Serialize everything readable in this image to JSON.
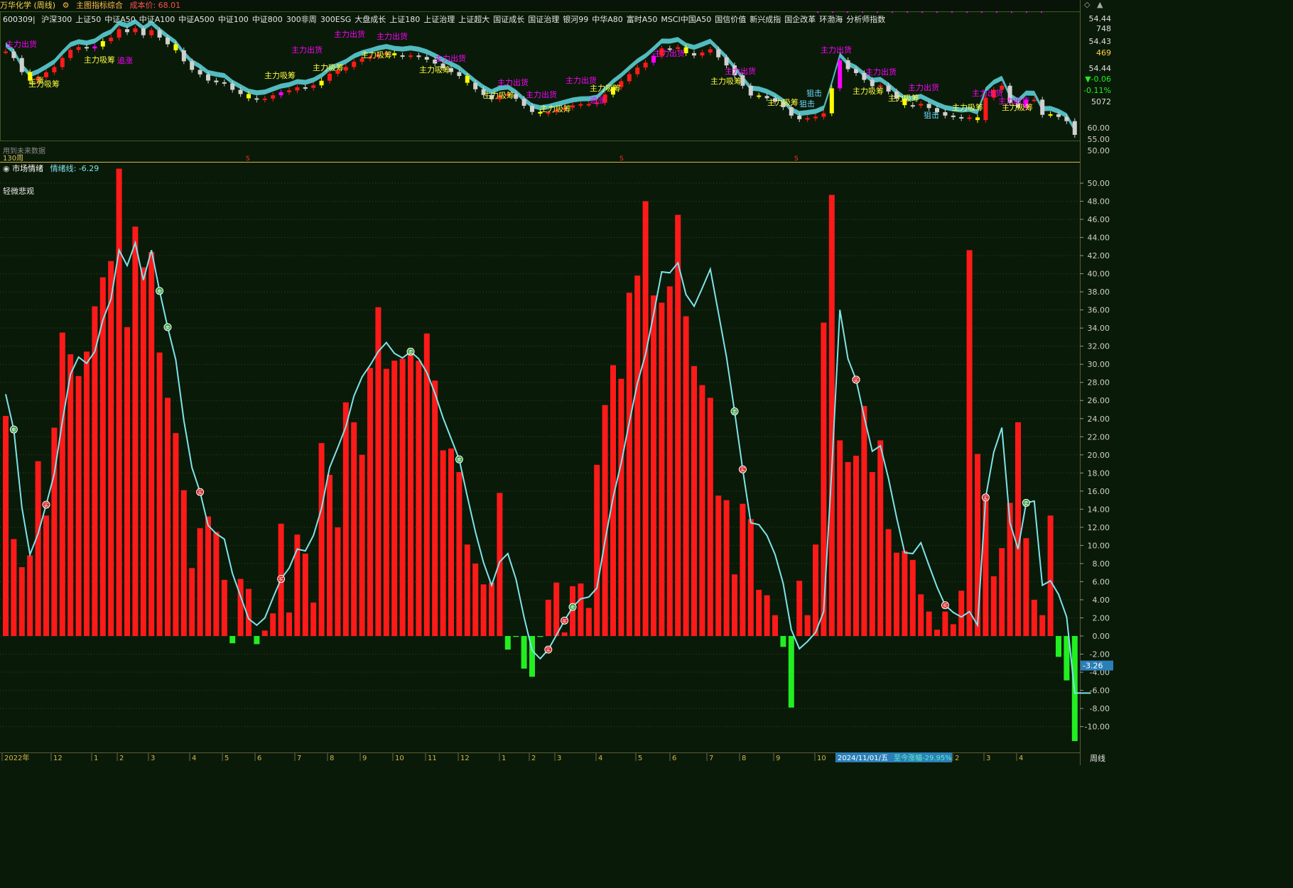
{
  "header": {
    "stock_name": "万华化学 (周线)",
    "indicator_name": "主图指标综合",
    "cost_label": "成本价: 68.01",
    "index_code": "600309",
    "index_list": [
      "沪深300",
      "上证50",
      "中证A50",
      "中证A100",
      "中证A500",
      "中证100",
      "中证800",
      "300非周",
      "300ESG",
      "大盘成长",
      "上证180",
      "上证治理",
      "上证超大",
      "国证成长",
      "国证治理",
      "银河99",
      "中华A80",
      "富时A50",
      "MSCI中国A50",
      "国信价值",
      "新兴成指",
      "国企改革",
      "环渤海",
      "分析师指数"
    ]
  },
  "window_controls": [
    "◇",
    "▲"
  ],
  "price_panel": {
    "right_labels": [
      "54.44",
      "748",
      "54.43",
      "469",
      "54.44",
      "▼-0.06",
      "-0.11%",
      "5072"
    ],
    "axis_ticks": [
      60.0,
      55.0,
      50.0
    ],
    "no_future_label": "用到未来数据",
    "period_label": "130周",
    "signal_texts": [
      "主力出货",
      "主力吸筹",
      "追涨",
      "狙击",
      "上涨"
    ],
    "colors": {
      "up": "#ff1a1a",
      "down": "#d0d0d0",
      "yellow": "#ffff00",
      "magenta": "#ff00ff",
      "ribbon_red": "#ff3a3a",
      "ribbon_cyan": "#5fd8e0"
    }
  },
  "indicator_panel": {
    "title": "市场情绪",
    "line_label": "情绪线:",
    "line_value": "-6.29",
    "mood_text": "轻微悲观",
    "current_marker": "-3.26"
  },
  "time_axis": {
    "labels": [
      "2022年",
      "12",
      "1",
      "2",
      "3",
      "4",
      "5",
      "6",
      "7",
      "8",
      "9",
      "10",
      "11",
      "12",
      "1",
      "2",
      "3",
      "4",
      "5",
      "6",
      "7",
      "8",
      "9",
      "10",
      "2",
      "3",
      "4"
    ],
    "highlight_date": "2024/11/01/五",
    "highlight_text": "至今涨幅-29.95%",
    "period_button": "周线"
  },
  "chart_data": {
    "type": "bar",
    "title": "市场情绪",
    "ylim": [
      -11.6,
      51.9
    ],
    "y_ticks": [
      -10,
      -8,
      -6,
      -4,
      -2,
      0,
      2,
      4,
      6,
      8,
      10,
      12,
      14,
      16,
      18,
      20,
      22,
      24,
      26,
      28,
      30,
      32,
      34,
      36,
      38,
      40,
      42,
      44,
      46,
      48,
      50
    ],
    "grid": true,
    "series": [
      {
        "name": "",
        "type": "bar",
        "values": [
          24.3,
          10.7,
          7.6,
          8.9,
          19.3,
          13.3,
          23.0,
          33.5,
          31.1,
          28.7,
          31.4,
          36.4,
          39.6,
          41.4,
          51.6,
          34.1,
          45.2,
          40.7,
          42.4,
          31.3,
          26.3,
          22.4,
          16.1,
          7.5,
          11.9,
          13.2,
          11.5,
          6.2,
          -0.8,
          6.3,
          5.2,
          -0.9,
          0.6,
          2.5,
          12.4,
          2.6,
          11.2,
          9.1,
          3.7,
          21.3,
          17.8,
          12.0,
          25.8,
          23.6,
          20.0,
          29.6,
          36.3,
          29.5,
          30.4,
          30.6,
          31.8,
          30.4,
          33.4,
          28.2,
          20.5,
          20.7,
          18.1,
          10.1,
          8.0,
          5.7,
          5.9,
          15.8,
          -1.5,
          -0.1,
          -3.6,
          -4.5,
          -0.1,
          4.0,
          5.9,
          0.4,
          5.5,
          5.8,
          3.1,
          18.9,
          25.5,
          29.9,
          28.4,
          37.9,
          39.8,
          48.0,
          37.6,
          36.8,
          38.6,
          46.5,
          35.3,
          29.8,
          27.7,
          26.3,
          15.5,
          15.0,
          6.8,
          14.6,
          12.9,
          5.1,
          4.5,
          2.3,
          -1.2,
          -7.9,
          6.1,
          2.3,
          10.1,
          34.6,
          48.7,
          21.6,
          19.2,
          19.9,
          25.4,
          18.1,
          21.6,
          11.8,
          9.2,
          9.4,
          8.4,
          4.6,
          2.7,
          0.7,
          2.7,
          1.3,
          5.0,
          42.6,
          20.1,
          15.2,
          6.6,
          9.7,
          14.7,
          23.6,
          10.8,
          4.0,
          2.3,
          13.3,
          -2.3,
          -4.9,
          -11.6
        ],
        "color_up": "#ff1a1a",
        "color_down": "#22ee22"
      },
      {
        "name": "情绪线",
        "type": "line",
        "values": [
          26.7,
          22.8,
          14.2,
          9.0,
          11.3,
          14.5,
          17.9,
          23.7,
          28.9,
          30.8,
          30.1,
          31.4,
          34.9,
          37.2,
          42.6,
          40.9,
          43.4,
          39.3,
          42.6,
          38.1,
          34.1,
          30.5,
          23.8,
          18.6,
          15.9,
          12.2,
          11.3,
          10.7,
          6.9,
          4.4,
          1.9,
          1.2,
          2.0,
          4.2,
          6.3,
          7.5,
          9.6,
          9.4,
          11.1,
          14.1,
          18.6,
          20.8,
          23.1,
          26.5,
          28.6,
          29.9,
          31.4,
          32.4,
          31.2,
          30.7,
          31.4,
          30.6,
          29.1,
          26.8,
          24.1,
          21.8,
          19.5,
          15.4,
          11.5,
          8.1,
          5.6,
          8.2,
          9.1,
          6.3,
          2.1,
          -1.6,
          -2.5,
          -1.5,
          0.1,
          1.7,
          3.2,
          4.1,
          4.3,
          5.3,
          10.5,
          15.3,
          19.1,
          23.6,
          27.9,
          31.1,
          35.5,
          40.2,
          40.1,
          41.2,
          37.7,
          36.4,
          38.4,
          40.5,
          35.7,
          30.8,
          24.8,
          18.4,
          12.5,
          12.3,
          11.1,
          9.0,
          5.8,
          0.7,
          -1.4,
          -0.6,
          0.4,
          2.7,
          18.4,
          36.0,
          30.6,
          28.3,
          24.2,
          20.4,
          21.0,
          17.4,
          13.1,
          9.2,
          9.1,
          10.3,
          7.8,
          5.4,
          3.4,
          2.6,
          2.1,
          2.7,
          1.2,
          15.3,
          20.3,
          23.0,
          12.5,
          9.6,
          14.7,
          14.9,
          5.6,
          6.1,
          4.6,
          2.1,
          -6.3,
          -6.3,
          -6.3
        ],
        "color": "#7fe3ec"
      }
    ],
    "buy_markers_idx": [
      1,
      19,
      20,
      50,
      56,
      70,
      90,
      105,
      126
    ],
    "sell_markers_idx": [
      5,
      24,
      34,
      69,
      67,
      91,
      105,
      116,
      121
    ],
    "y_marker_current": -3.26
  }
}
